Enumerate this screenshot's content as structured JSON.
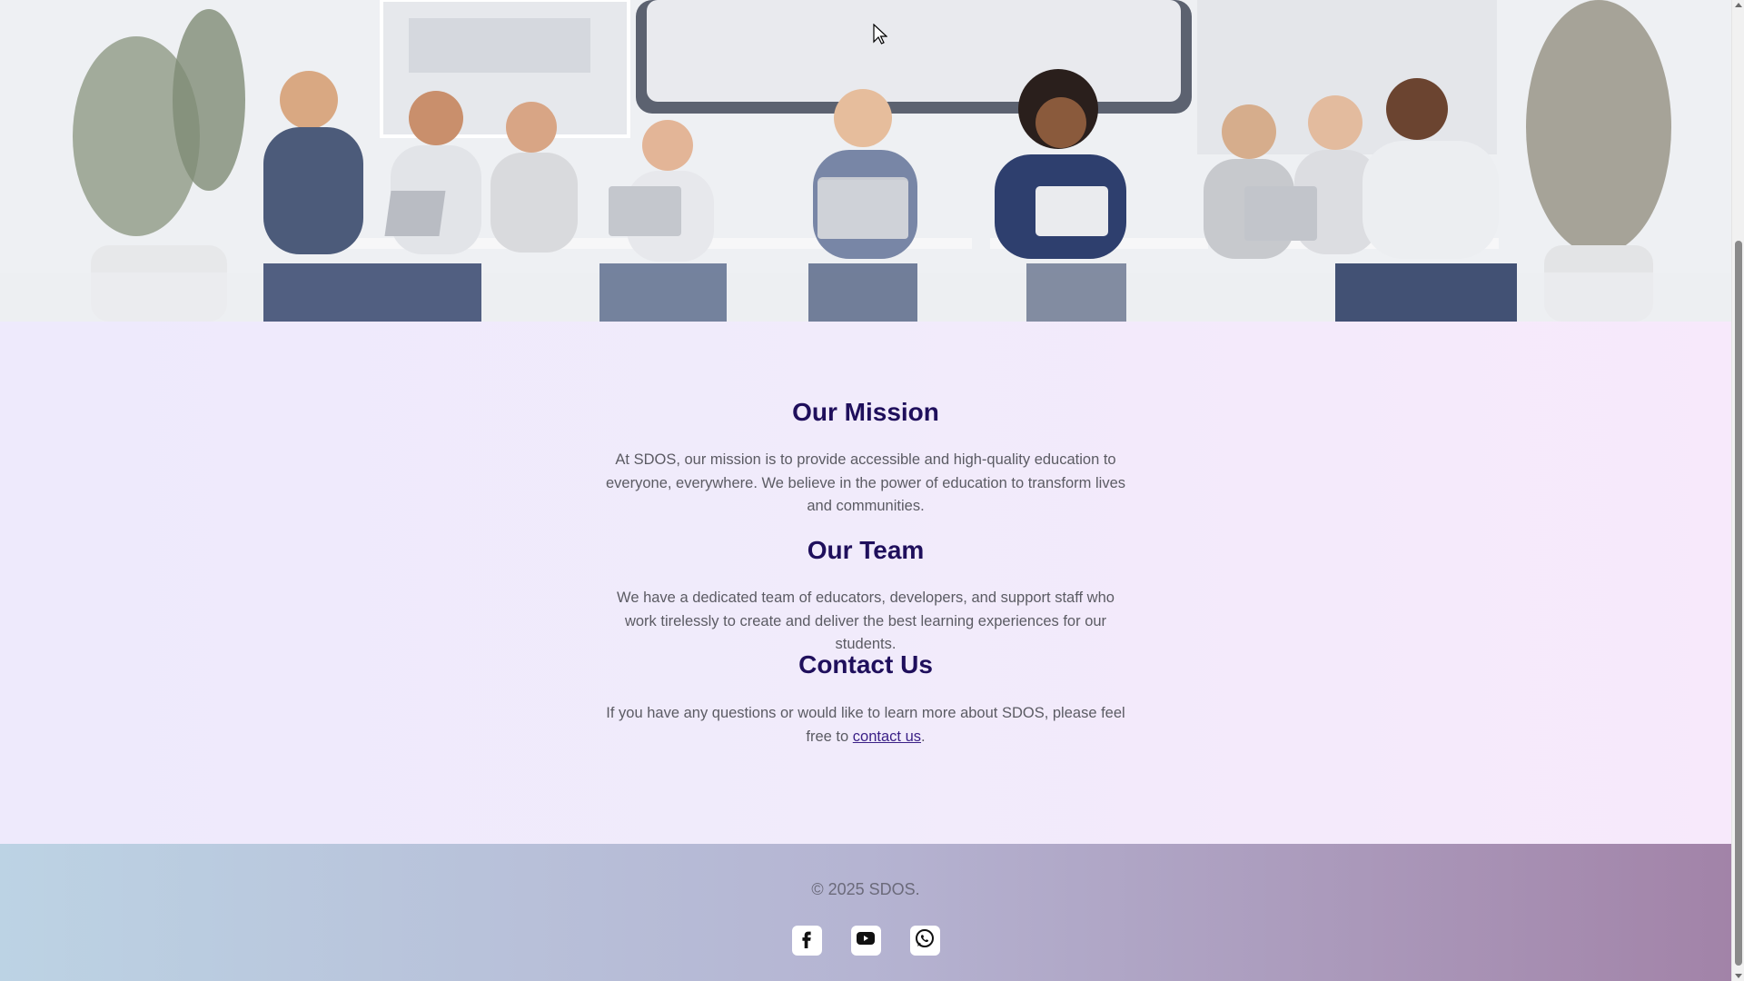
{
  "hero": {
    "image_name": "students-studying-with-laptops-illustration"
  },
  "mission": {
    "title": "Our Mission",
    "text": "At SDOS, our mission is to provide accessible and high-quality education to everyone, everywhere. We believe in the power of education to transform lives and communities."
  },
  "team": {
    "title": "Our Team",
    "text": "We have a dedicated team of educators, developers, and support staff who work tirelessly to create and deliver the best learning experiences for our students."
  },
  "contact": {
    "title": "Contact Us",
    "text_before": "If you have any questions or would like to learn more about SDOS, please feel free to ",
    "link_label": "contact us",
    "text_after": "."
  },
  "footer": {
    "copyright": "© 2025 SDOS.",
    "socials": [
      {
        "icon": "facebook-icon"
      },
      {
        "icon": "youtube-icon"
      },
      {
        "icon": "whatsapp-icon"
      }
    ]
  },
  "colors": {
    "heading": "#1f0f5c",
    "body_text": "#5b5b63",
    "link": "#3a1f86"
  }
}
